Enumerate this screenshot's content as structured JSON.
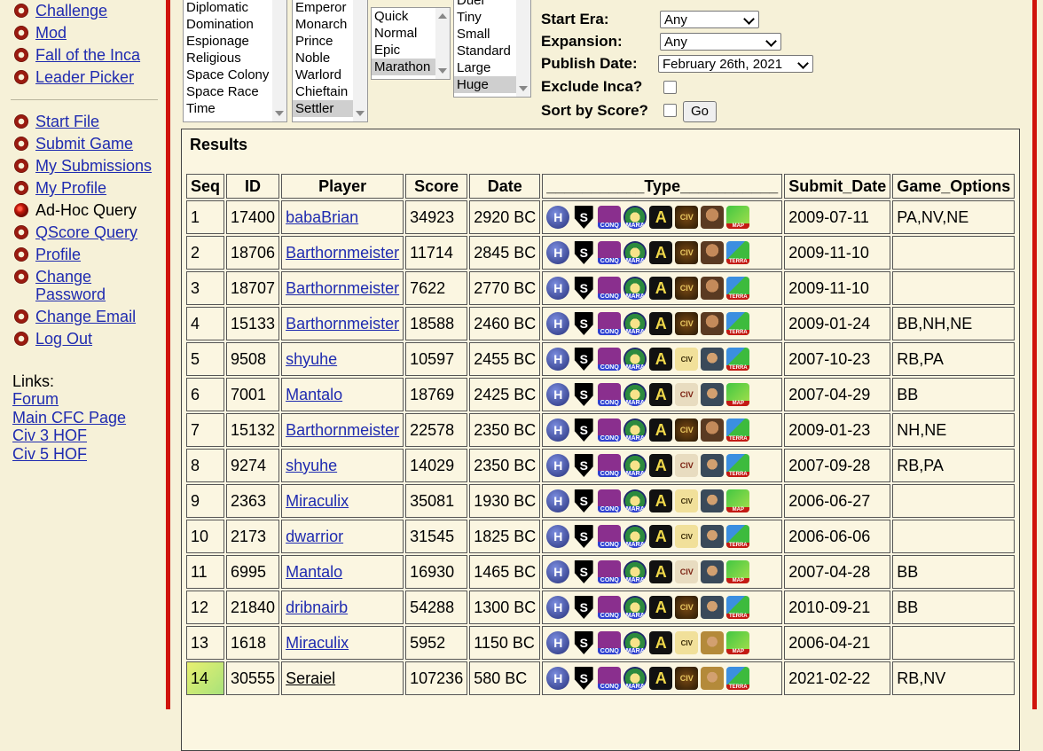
{
  "sidebar": {
    "nav1": [
      {
        "label": "Challenge",
        "link": true
      },
      {
        "label": "Mod",
        "link": true
      },
      {
        "label": "Fall of the Inca",
        "link": true
      },
      {
        "label": "Leader Picker",
        "link": true
      }
    ],
    "nav2": [
      {
        "label": "Start File",
        "link": true
      },
      {
        "label": "Submit Game",
        "link": true
      },
      {
        "label": "My Submissions",
        "link": true
      },
      {
        "label": "My Profile",
        "link": true
      },
      {
        "label": "Ad-Hoc Query",
        "link": false
      },
      {
        "label": "QScore Query",
        "link": true
      },
      {
        "label": "Profile",
        "link": true
      },
      {
        "label": "Change Password",
        "link": true
      },
      {
        "label": "Change Email",
        "link": true
      },
      {
        "label": "Log Out",
        "link": true
      }
    ],
    "links_label": "Links:",
    "links": [
      "Forum",
      "Main CFC Page",
      "Civ 3 HOF",
      "Civ 5 HOF"
    ]
  },
  "filters": {
    "victory_list": [
      "Diplomatic",
      "Domination",
      "Espionage",
      "Religious",
      "Space Colony",
      "Space Race",
      "Time"
    ],
    "difficulty_list": [
      "Emperor",
      "Monarch",
      "Prince",
      "Noble",
      "Warlord",
      "Chieftain",
      "Settler"
    ],
    "difficulty_selected": "Settler",
    "speed_list": [
      "Quick",
      "Normal",
      "Epic",
      "Marathon"
    ],
    "speed_selected": "Marathon",
    "size_list": [
      "Duel",
      "Tiny",
      "Small",
      "Standard",
      "Large",
      "Huge"
    ],
    "size_selected": "Huge",
    "start_era_label": "Start Era:",
    "start_era_value": "Any",
    "expansion_label": "Expansion:",
    "expansion_value": "Any",
    "publish_date_label": "Publish Date:",
    "publish_date_value": "February 26th, 2021",
    "exclude_inca_label": "Exclude Inca?",
    "sort_by_score_label": "Sort by Score?",
    "go_label": "Go"
  },
  "results": {
    "title": "Results",
    "columns": [
      "Seq",
      "ID",
      "Player",
      "Score",
      "Date",
      "___________Type___________",
      "Submit_Date",
      "Game_Options"
    ],
    "rows": [
      {
        "seq": "1",
        "id": "17400",
        "player": "babaBrian",
        "score": "34923",
        "date": "2920 BC",
        "submit": "2009-07-11",
        "options": "PA,NV,NE",
        "icons": [
          "h",
          "s",
          "conq",
          "mara",
          "a",
          "civ",
          "face",
          "green"
        ]
      },
      {
        "seq": "2",
        "id": "18706",
        "player": "Barthornmeister",
        "score": "11714",
        "date": "2845 BC",
        "submit": "2009-11-10",
        "options": "",
        "icons": [
          "h",
          "s",
          "conq",
          "mara",
          "a",
          "civ",
          "face",
          "map"
        ]
      },
      {
        "seq": "3",
        "id": "18707",
        "player": "Barthornmeister",
        "score": "7622",
        "date": "2770 BC",
        "submit": "2009-11-10",
        "options": "",
        "icons": [
          "h",
          "s",
          "conq",
          "mara",
          "a",
          "civ",
          "face",
          "map"
        ]
      },
      {
        "seq": "4",
        "id": "15133",
        "player": "Barthornmeister",
        "score": "18588",
        "date": "2460 BC",
        "submit": "2009-01-24",
        "options": "BB,NH,NE",
        "icons": [
          "h",
          "s",
          "conq",
          "mara",
          "a",
          "civ",
          "face",
          "map"
        ]
      },
      {
        "seq": "5",
        "id": "9508",
        "player": "shyuhe",
        "score": "10597",
        "date": "2455 BC",
        "submit": "2007-10-23",
        "options": "RB,PA",
        "icons": [
          "h",
          "s",
          "conq",
          "mara",
          "a",
          "civl",
          "face2",
          "map"
        ]
      },
      {
        "seq": "6",
        "id": "7001",
        "player": "Mantalo",
        "score": "18769",
        "date": "2425 BC",
        "submit": "2007-04-29",
        "options": "BB",
        "icons": [
          "h",
          "s",
          "conq",
          "mara",
          "a",
          "civx",
          "face2",
          "green"
        ]
      },
      {
        "seq": "7",
        "id": "15132",
        "player": "Barthornmeister",
        "score": "22578",
        "date": "2350 BC",
        "submit": "2009-01-23",
        "options": "NH,NE",
        "icons": [
          "h",
          "s",
          "conq",
          "mara",
          "a",
          "civ",
          "face",
          "map"
        ]
      },
      {
        "seq": "8",
        "id": "9274",
        "player": "shyuhe",
        "score": "14029",
        "date": "2350 BC",
        "submit": "2007-09-28",
        "options": "RB,PA",
        "icons": [
          "h",
          "s",
          "conq",
          "mara",
          "a",
          "civx",
          "face2",
          "map"
        ]
      },
      {
        "seq": "9",
        "id": "2363",
        "player": "Miraculix",
        "score": "35081",
        "date": "1930 BC",
        "submit": "2006-06-27",
        "options": "",
        "icons": [
          "h",
          "s",
          "conq",
          "mara",
          "a",
          "civl",
          "face2",
          "green"
        ]
      },
      {
        "seq": "10",
        "id": "2173",
        "player": "dwarrior",
        "score": "31545",
        "date": "1825 BC",
        "submit": "2006-06-06",
        "options": "",
        "icons": [
          "h",
          "s",
          "conq",
          "mara",
          "a",
          "civl",
          "face2",
          "map"
        ]
      },
      {
        "seq": "11",
        "id": "6995",
        "player": "Mantalo",
        "score": "16930",
        "date": "1465 BC",
        "submit": "2007-04-28",
        "options": "BB",
        "icons": [
          "h",
          "s",
          "conq",
          "mara",
          "a",
          "civx",
          "face2",
          "green"
        ]
      },
      {
        "seq": "12",
        "id": "21840",
        "player": "dribnairb",
        "score": "54288",
        "date": "1300 BC",
        "submit": "2010-09-21",
        "options": "BB",
        "icons": [
          "h",
          "s",
          "conq",
          "mara",
          "a",
          "civ",
          "face2",
          "map"
        ]
      },
      {
        "seq": "13",
        "id": "1618",
        "player": "Miraculix",
        "score": "5952",
        "date": "1150 BC",
        "submit": "2006-04-21",
        "options": "",
        "icons": [
          "h",
          "s",
          "conq",
          "mara",
          "a",
          "civl",
          "face3",
          "green"
        ]
      },
      {
        "seq": "14",
        "id": "30555",
        "player": "Seraiel",
        "score": "107236",
        "date": "580 BC",
        "submit": "2021-02-22",
        "options": "RB,NV",
        "icons": [
          "h",
          "s",
          "conq",
          "mara",
          "a",
          "civ",
          "face3",
          "map"
        ],
        "highlight": true
      }
    ]
  }
}
